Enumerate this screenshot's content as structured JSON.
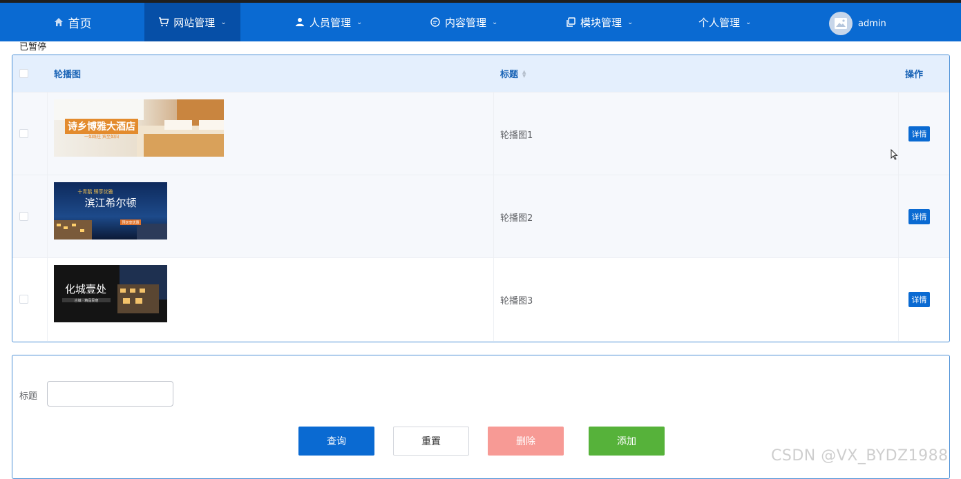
{
  "nav": {
    "home": "首页",
    "site": "网站管理",
    "people": "人员管理",
    "content": "内容管理",
    "module": "模块管理",
    "personal": "个人管理",
    "user": "admin"
  },
  "status_text": "已暂停",
  "table": {
    "headers": {
      "image": "轮播图",
      "title": "标题",
      "ops": "操作"
    },
    "rows": [
      {
        "title": "轮播图1",
        "detail": "详情",
        "banner_main": "诗乡博雅大酒店",
        "banner_sub": "一如既往  宾至如归"
      },
      {
        "title": "轮播图2",
        "detail": "详情",
        "banner_top": "十青鹅  臻享优雅",
        "banner_main": "滨江希尔顿",
        "banner_sub": "预定享优惠"
      },
      {
        "title": "轮播图3",
        "detail": "详情",
        "banner_main": "化城壹处",
        "banner_sub": "古镇 · 精品民宿"
      }
    ]
  },
  "form": {
    "title_label": "标题",
    "title_value": "",
    "query": "查询",
    "reset": "重置",
    "delete": "删除",
    "add": "添加"
  },
  "watermark": "CSDN @VX_BYDZ1988",
  "colors": {
    "primary": "#0a6ad2",
    "nav_active": "#064fa7",
    "danger": "#f79a95",
    "success": "#56b23a",
    "header_bg": "#e4effd"
  }
}
